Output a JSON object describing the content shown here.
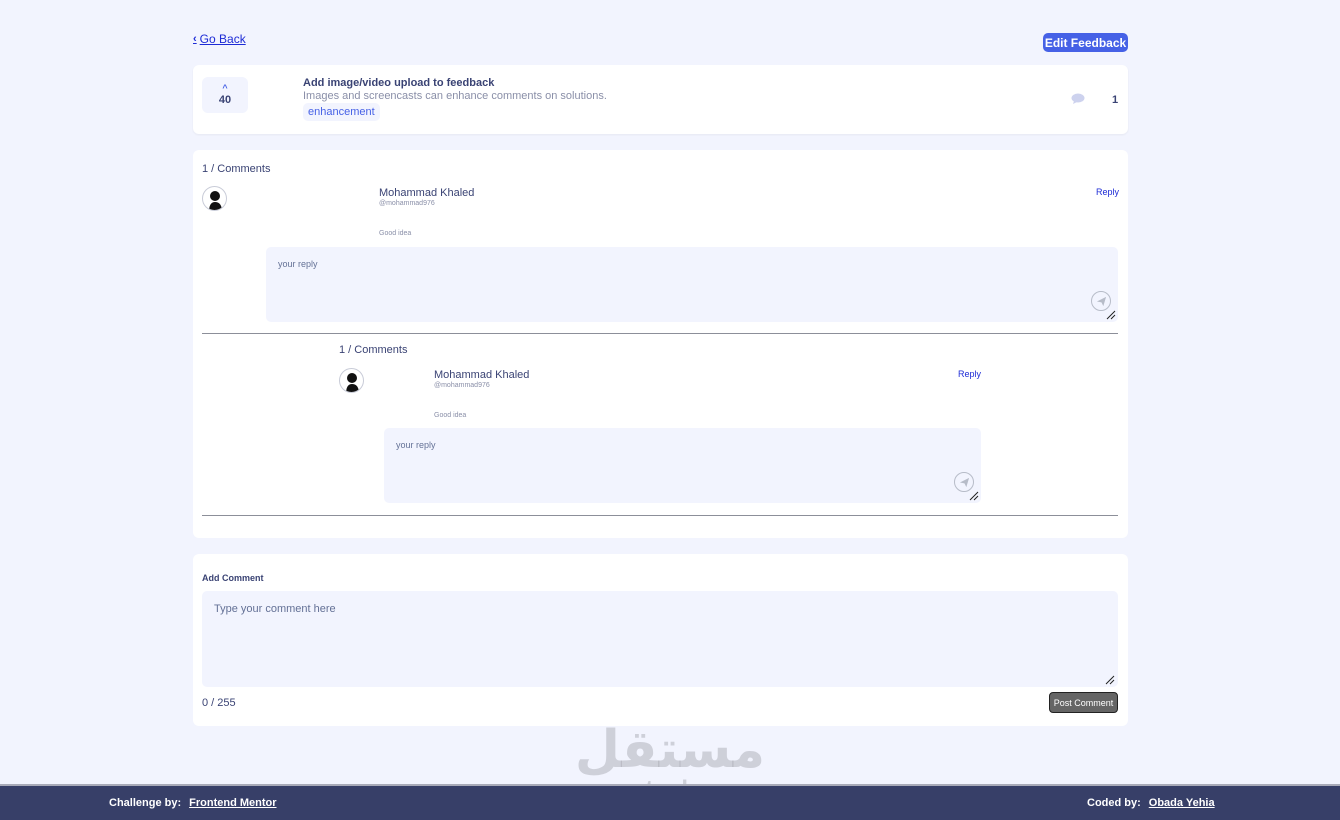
{
  "nav": {
    "back_label": "Go Back",
    "edit_label": "Edit Feedback"
  },
  "feedback": {
    "votes": "40",
    "title": "Add image/video upload to feedback",
    "description": "Images and screencasts can enhance comments on solutions.",
    "tag": "enhancement",
    "comment_count": "1"
  },
  "thread": {
    "count_label": "1 / Comments",
    "comment": {
      "author": "Mohammad Khaled",
      "handle": "@mohammad976",
      "text": "Good idea",
      "reply_label": "Reply",
      "reply_placeholder": "your reply"
    },
    "nested": {
      "count_label": "1 / Comments",
      "comment": {
        "author": "Mohammad Khaled",
        "handle": "@mohammad976",
        "text": "Good idea",
        "reply_label": "Reply",
        "reply_placeholder": "your reply"
      }
    }
  },
  "add_comment": {
    "title": "Add Comment",
    "placeholder": "Type your comment here",
    "char_count": "0 / 255",
    "post_label": "Post Comment"
  },
  "watermark": {
    "arabic": "مستقل",
    "latin": "mostaql.com"
  },
  "footer": {
    "challenge_label": "Challenge by:",
    "challenge_link": "Frontend Mentor",
    "coded_label": "Coded by:",
    "coded_link": "Obada Yehia"
  },
  "colors": {
    "accent": "#4661e6",
    "text": "#3a4374",
    "footer": "#373f68",
    "background": "#f2f4fe"
  }
}
